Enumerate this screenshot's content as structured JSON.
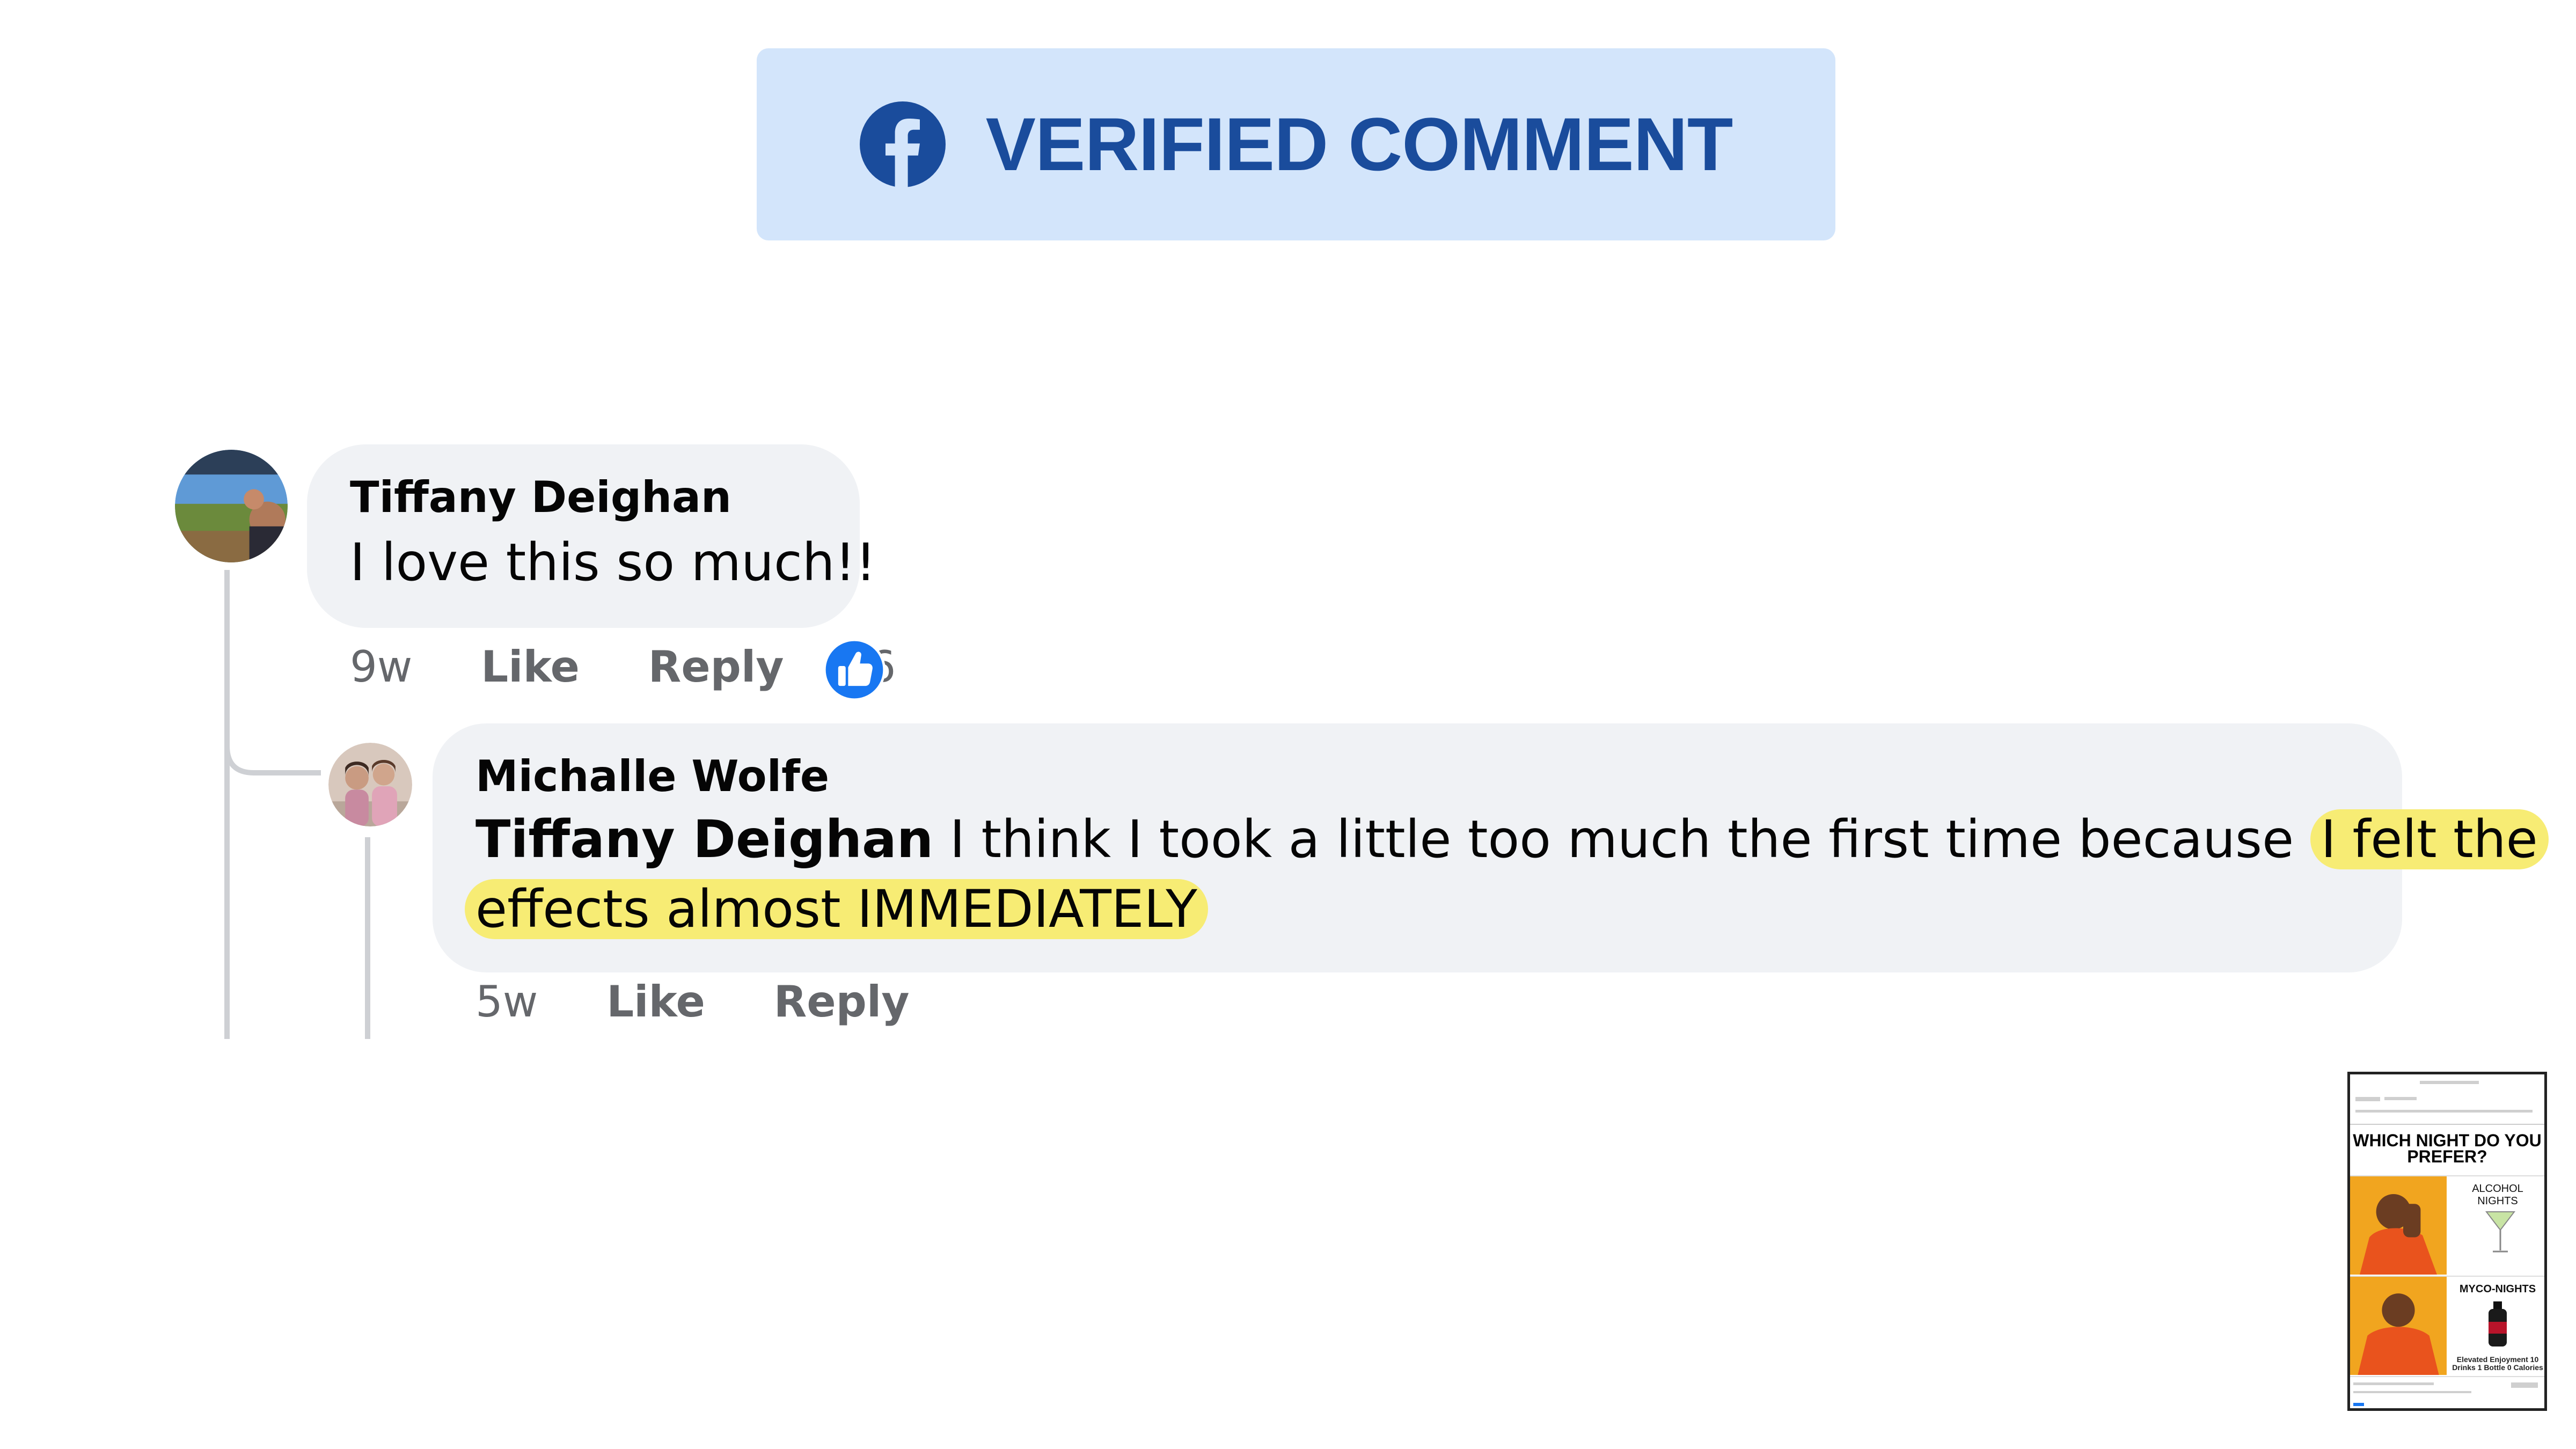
{
  "banner": {
    "title": "VERIFIED COMMENT",
    "icon": "facebook-logo-icon",
    "background": "#d3e5fb",
    "text_color": "#1a4c9c"
  },
  "comment": {
    "author": "Tiffany Deighan",
    "text": "I love this so much!!",
    "time": "9w",
    "like_label": "Like",
    "reply_label": "Reply",
    "reaction_count": "6",
    "reaction_icon": "thumbs-up-icon"
  },
  "reply": {
    "author": "Michalle Wolfe",
    "mention": "Tiffany Deighan",
    "text_plain": " I think I took a little too much the first time because ",
    "text_highlight_1": "I felt the",
    "text_highlight_2": "effects almost IMMEDIATELY",
    "highlight_color": "#f7ec74",
    "time": "5w",
    "like_label": "Like",
    "reply_label": "Reply"
  },
  "thumbnail": {
    "question": "WHICH NIGHT DO YOU PREFER?",
    "option_1": "ALCOHOL NIGHTS",
    "option_2": "MYCO-NIGHTS",
    "option_2_sub": "Elevated Enjoyment 10 Drinks 1 Bottle 0 Calories"
  },
  "colors": {
    "bubble": "#f0f2f5",
    "secondary_text": "#65676b",
    "facebook_blue": "#1877f2"
  }
}
